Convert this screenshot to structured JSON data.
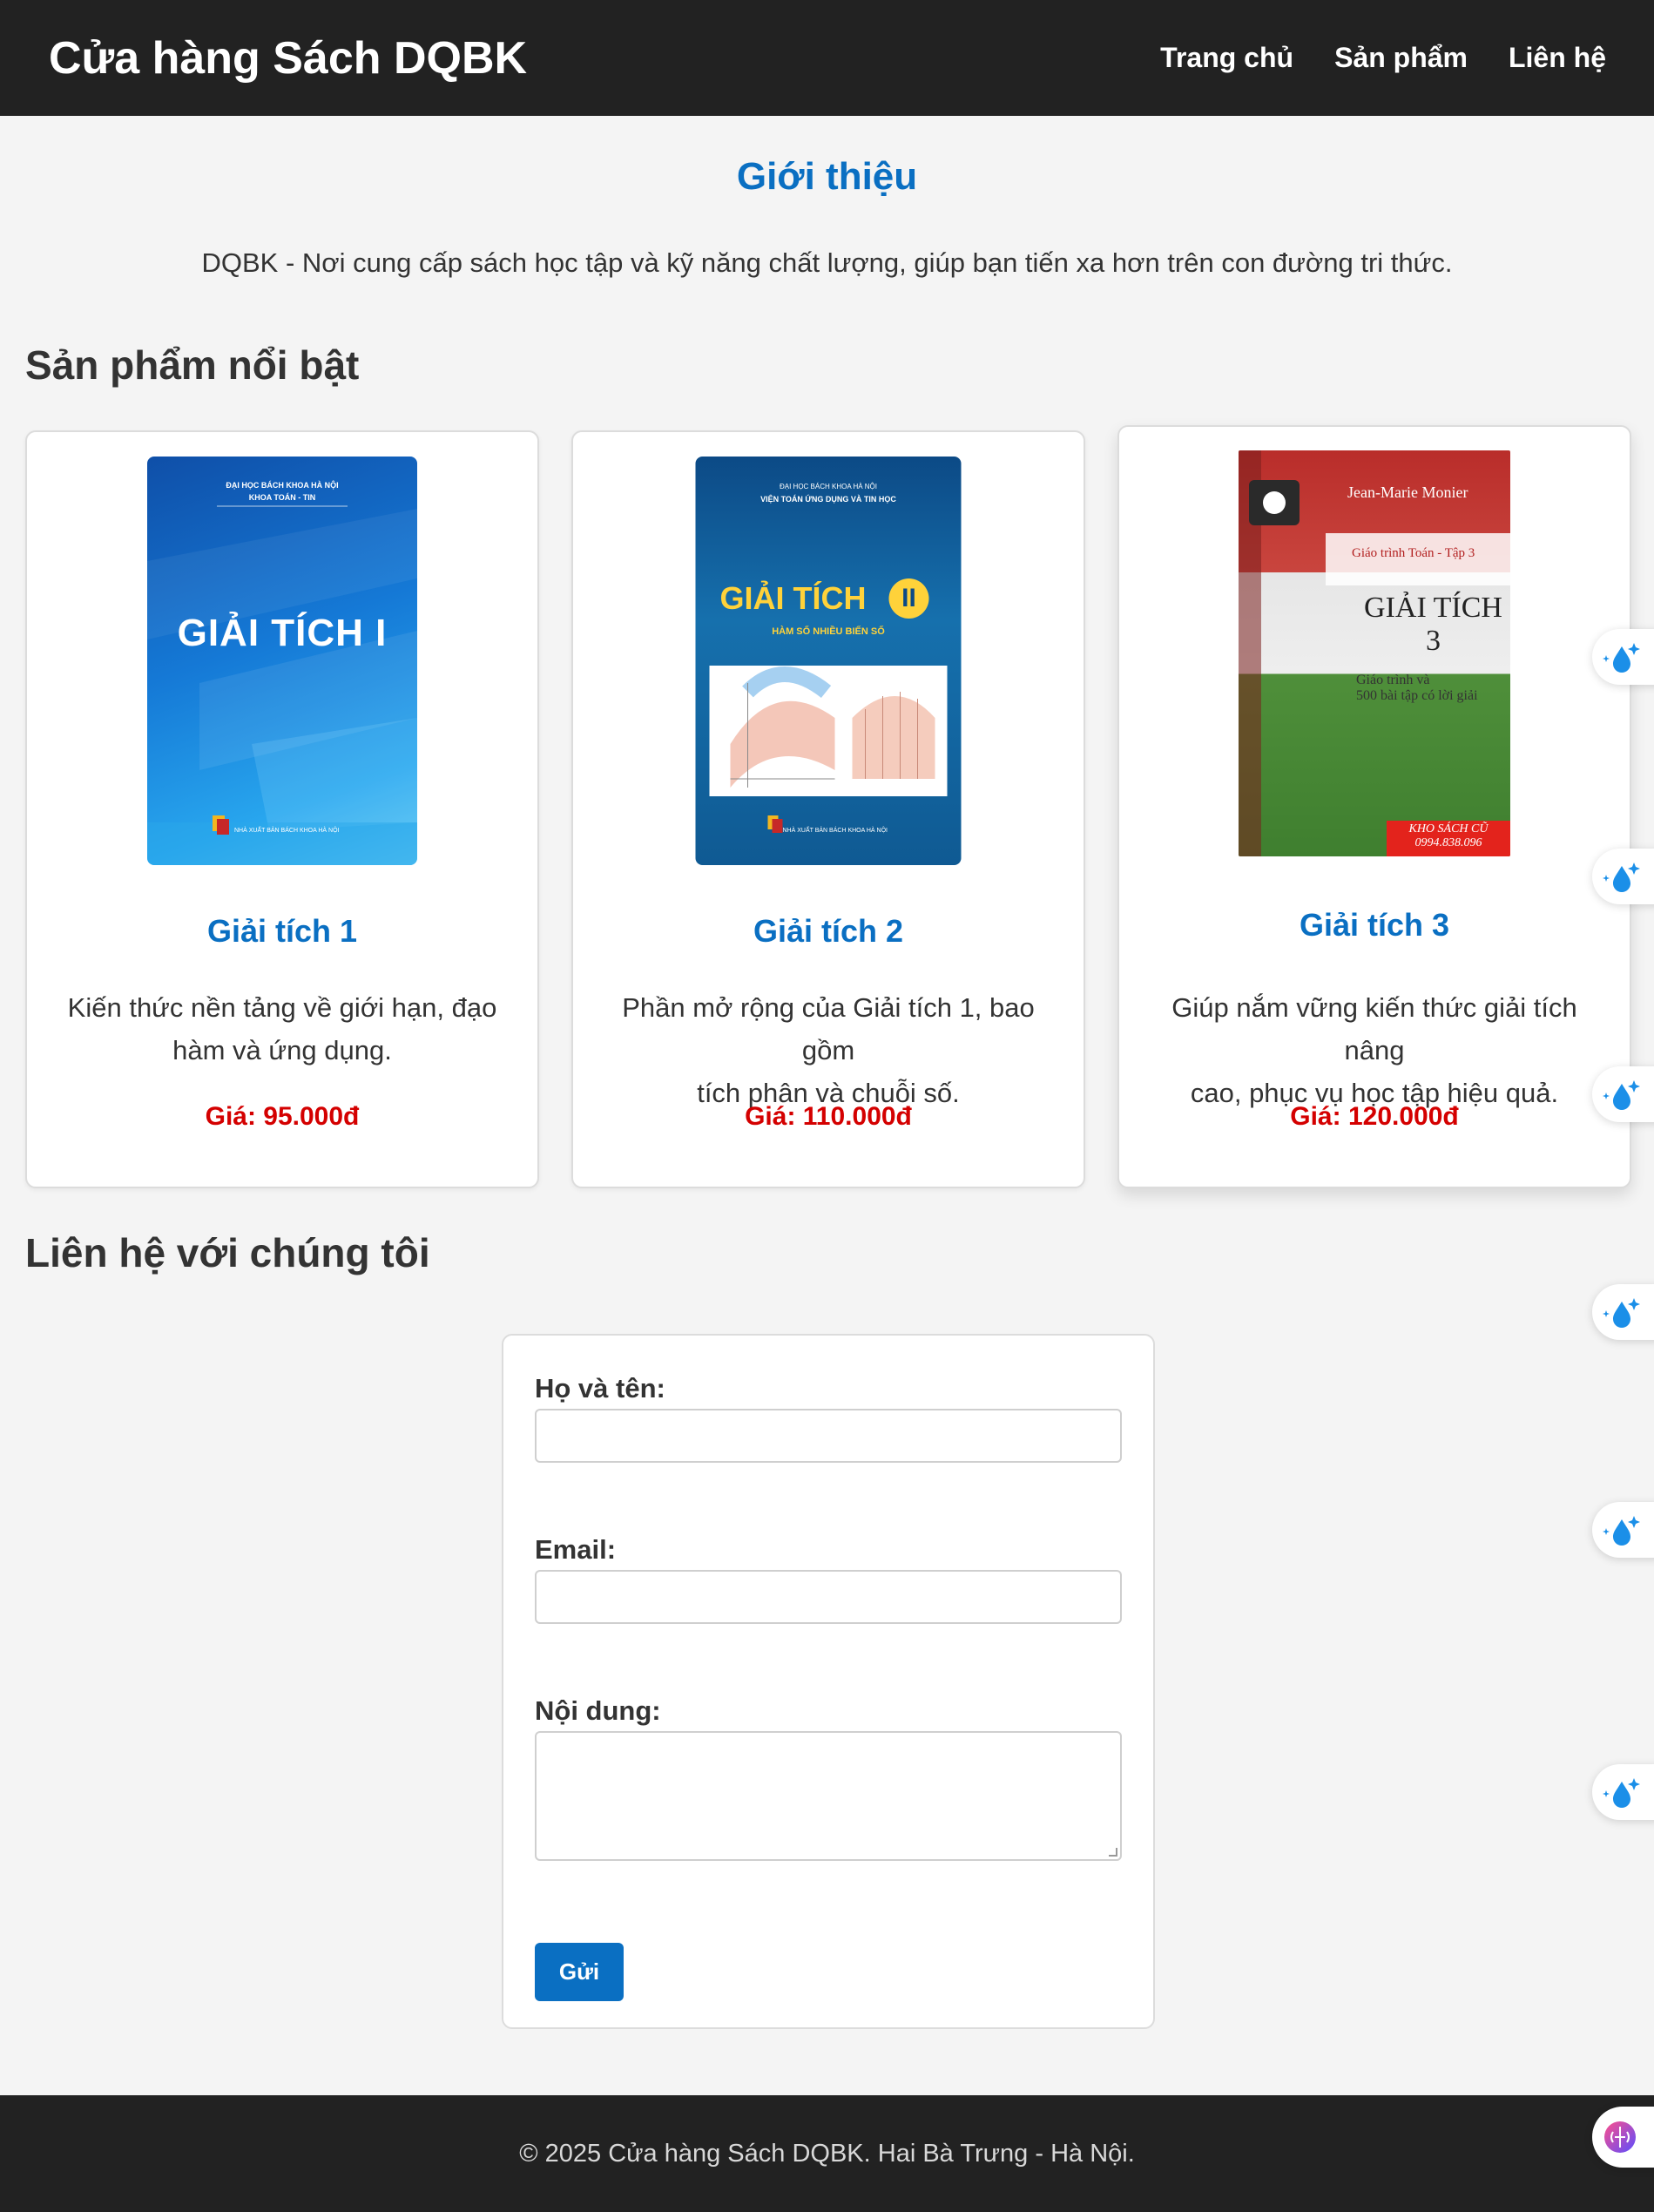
{
  "header": {
    "brand": "Cửa hàng Sách DQBK",
    "nav": [
      "Trang chủ",
      "Sản phẩm",
      "Liên hệ"
    ]
  },
  "intro": {
    "title": "Giới thiệu",
    "text": "DQBK - Nơi cung cấp sách học tập và kỹ năng chất lượng, giúp bạn tiến xa hơn trên con đường tri thức."
  },
  "products": {
    "heading": "Sản phẩm nổi bật",
    "items": [
      {
        "title": "Giải tích 1",
        "desc_line1": "Kiến thức nền tảng về giới hạn, đạo",
        "desc_line2": "hàm và ứng dụng.",
        "price": "Giá: 95.000đ",
        "cover": {
          "publisher": "ĐẠI HỌC BÁCH KHOA HÀ NỘI",
          "dept": "KHOA TOÁN - TIN",
          "book_title": "GIẢI TÍCH I",
          "press": "NHÀ XUẤT BẢN BÁCH KHOA HÀ NỘI"
        }
      },
      {
        "title": "Giải tích 2",
        "desc_line1": "Phần mở rộng của Giải tích 1, bao gồm",
        "desc_line2": "tích phân và chuỗi số.",
        "price": "Giá: 110.000đ",
        "cover": {
          "publisher": "ĐẠI HỌC BÁCH KHOA HÀ NỘI",
          "dept": "VIỆN TOÁN ỨNG DỤNG VÀ TIN HỌC",
          "book_title": "GIẢI TÍCH",
          "numeral": "II",
          "subtitle": "HÀM SỐ NHIỀU BIẾN SỐ",
          "press": "NHÀ XUẤT BẢN BÁCH KHOA HÀ NỘI"
        }
      },
      {
        "title": "Giải tích 3",
        "desc_line1": "Giúp nắm vững kiến thức giải tích nâng",
        "desc_line2": "cao, phục vụ học tập hiệu quả.",
        "price": "Giá: 120.000đ",
        "cover": {
          "author": "Jean-Marie Monier",
          "series": "Giáo trình Toán - Tập 3",
          "book_title": "GIẢI TÍCH 3",
          "subtitle1": "Giáo trình và",
          "subtitle2": "500 bài tập có lời giải",
          "stamp1": "KHO SÁCH CŨ",
          "stamp2": "0994.838.096"
        }
      }
    ]
  },
  "contact": {
    "heading": "Liên hệ với chúng tôi",
    "name_label": "Họ và tên:",
    "email_label": "Email:",
    "message_label": "Nội dung:",
    "submit": "Gửi"
  },
  "footer": {
    "text": "© 2025 Cửa hàng Sách DQBK. Hai Bà Trưng - Hà Nội."
  },
  "colors": {
    "accent": "#0a6fc2",
    "price": "#d40000",
    "header_bg": "#222222"
  },
  "icons": [
    "drop-sparkle-icon",
    "brain-icon"
  ]
}
